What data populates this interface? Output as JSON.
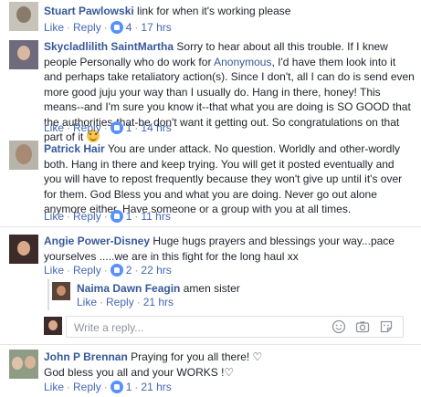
{
  "common": {
    "like_label": "Like",
    "reply_label": "Reply",
    "dot": "·"
  },
  "comments": [
    {
      "name": "Stuart Pawlowski",
      "text": "link for when it's working please",
      "likes": "4",
      "time": "17 hrs"
    },
    {
      "name": "Skycladlilith SaintMartha",
      "text_a": "Sorry to hear about all this trouble. If I knew people Personally who do work for",
      "mention": "Anonymous",
      "text_b": ", I'd have them look into it and perhaps take retaliatory action(s). Since I don't, all I can do is send even more good juju your way than I usually do. Hang in there, honey! This means--and I'm sure you know it--that what you are doing is SO GOOD that the authorities-that-be don't want it getting out. So congratulations on that part of it",
      "likes": "1",
      "time": "14 hrs"
    },
    {
      "name": "Patrick Hair",
      "text": "You are under attack. No question. Worldly and other-wordly both. Hang in there and keep trying. You will get it posted eventually and you will have to repost frequently because they won't give up until it's over for them. God Bless you and what you are doing. Never go out alone anymore either. Have someone or a group with you at all times.",
      "likes": "1",
      "time": "11 hrs"
    },
    {
      "name": "Angie Power-Disney",
      "text": "Huge hugs prayers and blessings your way...pace yourselves .....we are in this fight for the long haul xx",
      "likes": "2",
      "time": "22 hrs"
    },
    {
      "name": "Naima Dawn Feagin",
      "text": "amen sister",
      "time": "21 hrs"
    },
    {
      "name": "John P Brennan",
      "text_line1": "Praying for you all there! ♡",
      "text_line2": "God bless you all and your WORKS !♡",
      "likes": "1",
      "time": "21 hrs"
    }
  ],
  "reply_box": {
    "placeholder": "Write a reply..."
  },
  "icons": [
    "like-thumb-icon",
    "emoji-icon",
    "camera-icon",
    "sticker-icon"
  ],
  "colors": {
    "name": "#365899",
    "link": "#4267b2",
    "meta": "#90949c",
    "like_badge": "#5890ff"
  }
}
